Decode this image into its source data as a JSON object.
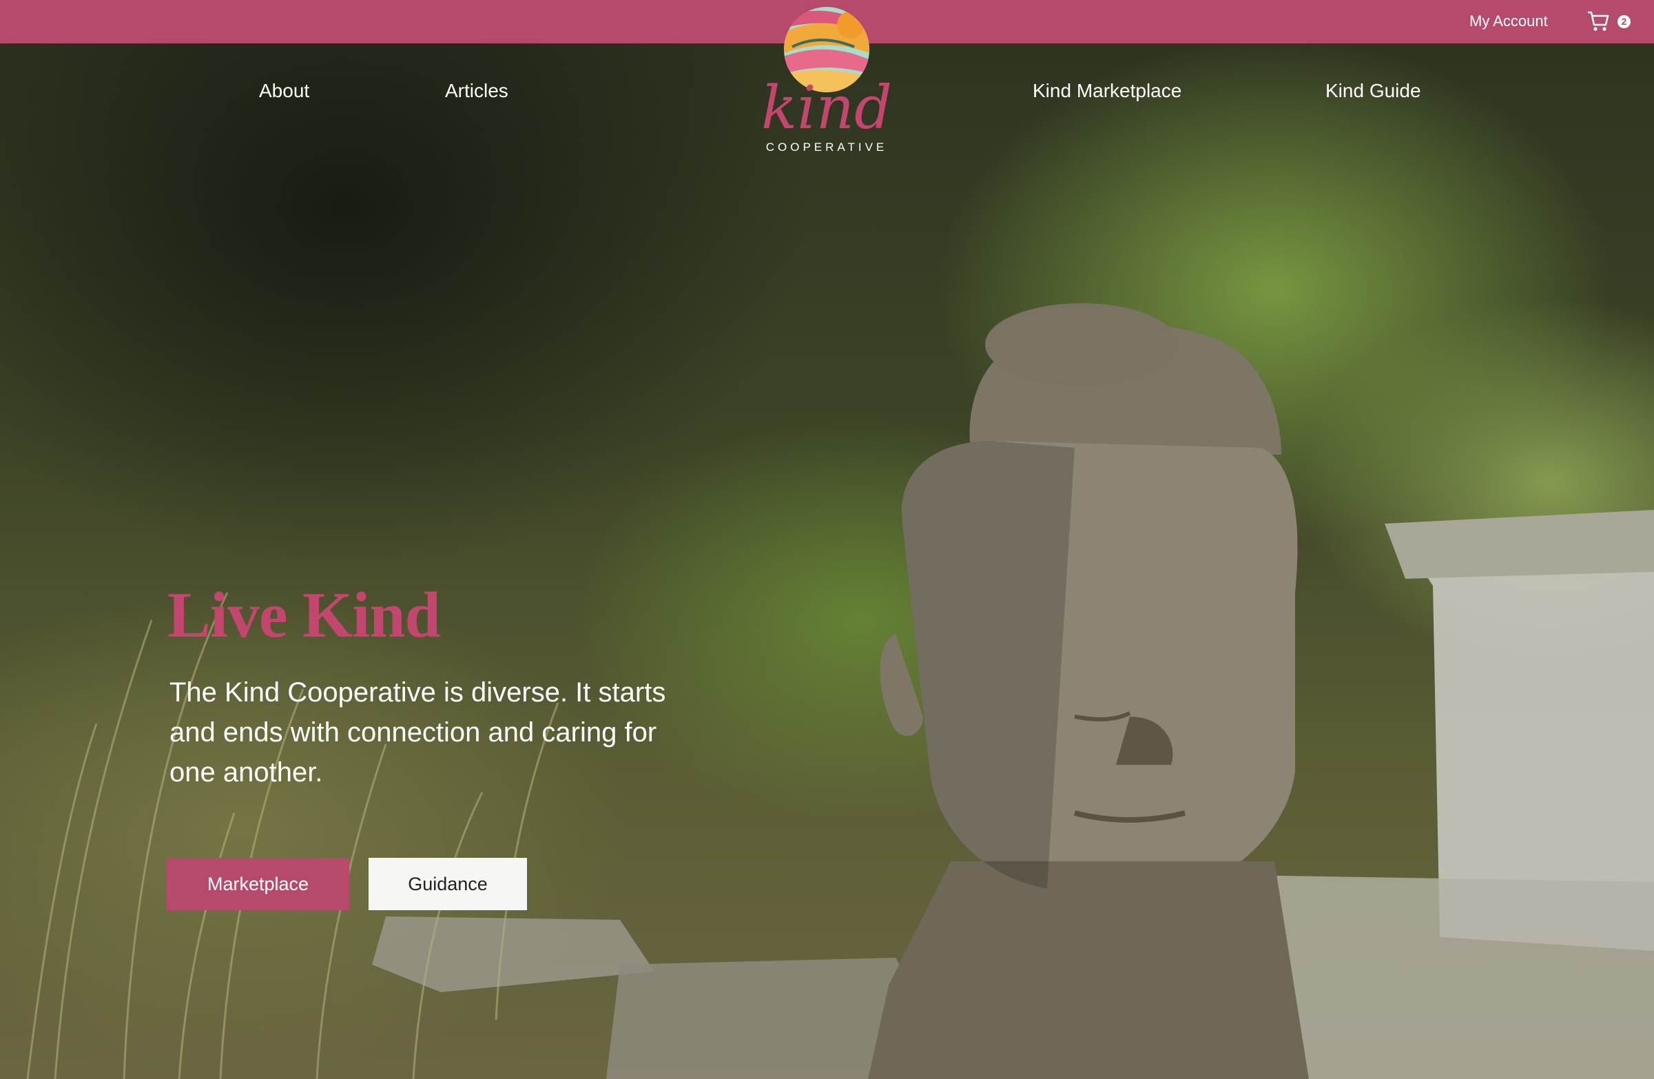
{
  "topbar": {
    "account_label": "My Account",
    "cart_count": "2",
    "background_color": "#b54a6b"
  },
  "nav": {
    "items": [
      {
        "label": "About"
      },
      {
        "label": "Articles"
      },
      {
        "label": "Kind Marketplace"
      },
      {
        "label": "Kind Guide"
      }
    ]
  },
  "logo": {
    "script_text": "kind",
    "subtitle": "COOPERATIVE",
    "brand_color": "#c2466d"
  },
  "hero": {
    "title": "Live Kind",
    "description": "The Kind Cooperative is diverse. It starts and ends with connection and caring for one another.",
    "primary_button": "Marketplace",
    "secondary_button": "Guidance",
    "background_image": "buddha-statue-in-garden"
  },
  "icons": {
    "cart": "shopping-cart-icon"
  }
}
